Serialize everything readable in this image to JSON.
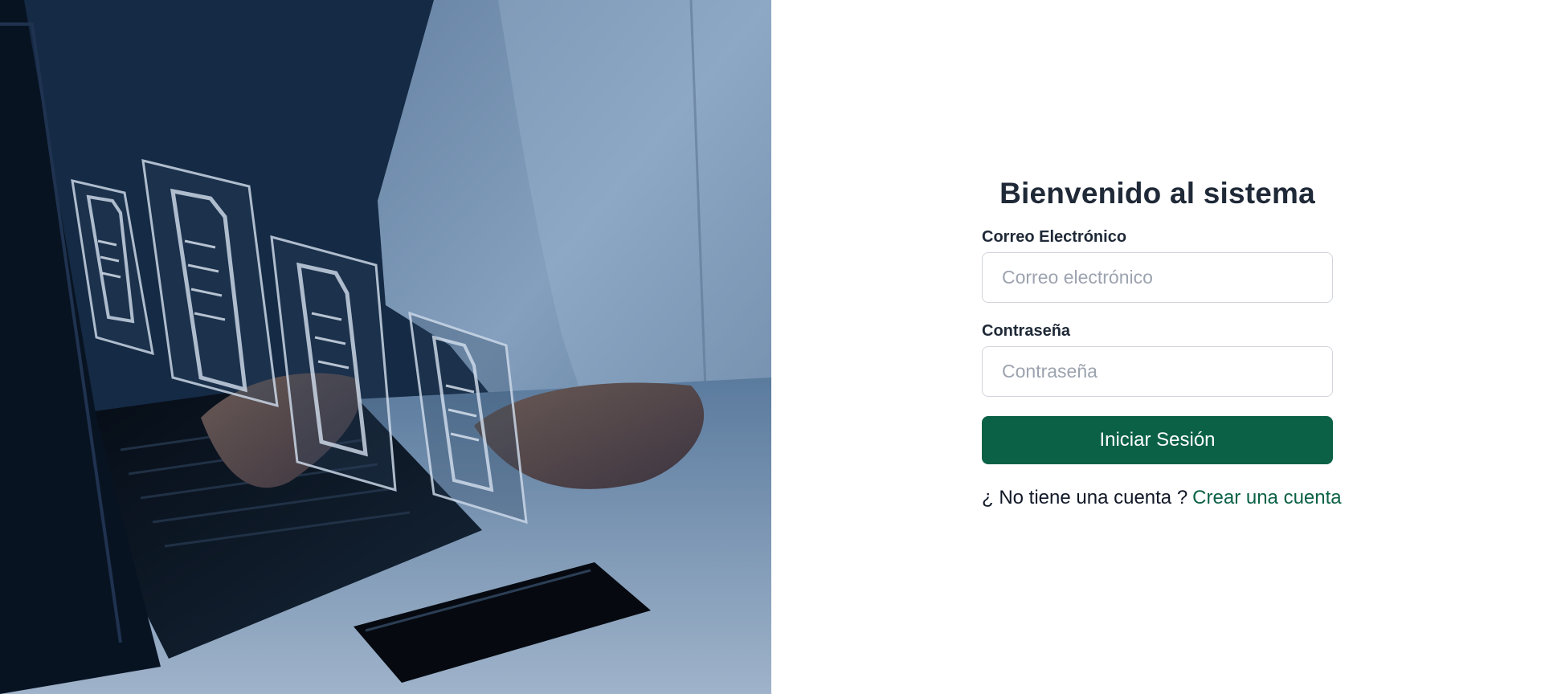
{
  "hero": {
    "image": "person-typing-laptop-with-floating-documents",
    "icon": "document-icon"
  },
  "login": {
    "title": "Bienvenido al sistema",
    "email_label": "Correo Electrónico",
    "email_placeholder": "Correo electrónico",
    "password_label": "Contraseña",
    "password_placeholder": "Contraseña",
    "submit_label": "Iniciar Sesión",
    "register_prompt": "¿ No tiene una cuenta ?",
    "register_link": "Crear una cuenta"
  },
  "colors": {
    "brand": "#0b6146",
    "title": "#1f2937",
    "input_border": "#d1d5db",
    "placeholder": "#9ca3af"
  }
}
